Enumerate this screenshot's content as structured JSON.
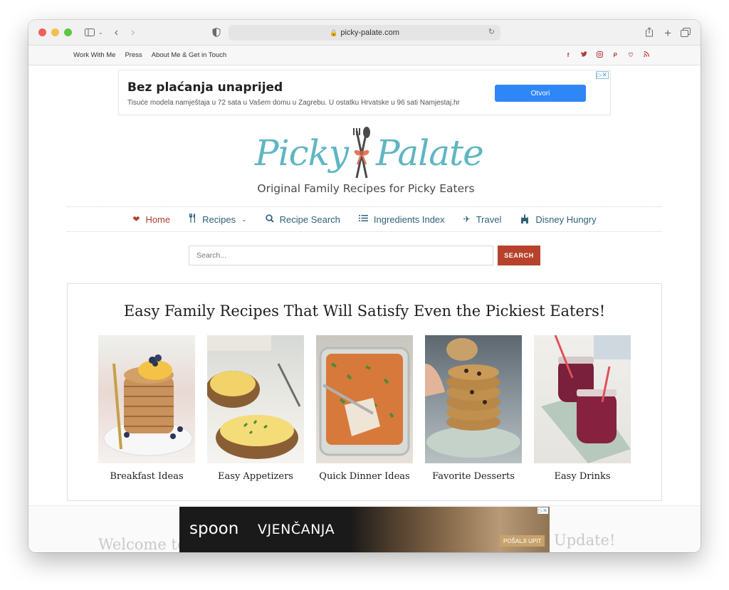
{
  "browser": {
    "url": "picky-palate.com",
    "traffic_lights": [
      "#ee5f57",
      "#f4bd4f",
      "#5ec545"
    ]
  },
  "bookmarks": [
    "Work With Me",
    "Press",
    "About Me & Get in Touch"
  ],
  "social_icons": [
    "facebook-icon",
    "twitter-icon",
    "instagram-icon",
    "pinterest-icon",
    "heart-icon",
    "rss-icon"
  ],
  "ad_top": {
    "title": "Bez plaćanja unaprijed",
    "subtitle": "Tisuće modela namještaja u 72 sata u Vašem domu u Zagrebu. U ostatku Hrvatske u 96 sati Namjestaj.hr",
    "button": "Otvori"
  },
  "logo": {
    "word1": "Picky",
    "word2": "Palate",
    "tagline": "Original Family Recipes for Picky Eaters"
  },
  "nav": {
    "items": [
      {
        "label": "Home",
        "icon": "heart-icon"
      },
      {
        "label": "Recipes",
        "icon": "utensils-icon"
      },
      {
        "label": "Recipe Search",
        "icon": "search-icon"
      },
      {
        "label": "Ingredients Index",
        "icon": "list-icon"
      },
      {
        "label": "Travel",
        "icon": "plane-icon"
      },
      {
        "label": "Disney Hungry",
        "icon": "castle-icon"
      }
    ]
  },
  "search": {
    "placeholder": "Search...",
    "button": "SEARCH"
  },
  "featured": {
    "heading": "Easy Family Recipes That Will Satisfy Even the Pickiest Eaters!",
    "cards": [
      {
        "label": "Breakfast Ideas"
      },
      {
        "label": "Easy Appetizers"
      },
      {
        "label": "Quick Dinner Ideas"
      },
      {
        "label": "Favorite Desserts"
      },
      {
        "label": "Easy Drinks"
      }
    ]
  },
  "below": {
    "left": "Welcome to",
    "right": "Update!"
  },
  "ad_bottom": {
    "brand": "spoon",
    "brand2": "VJENČANJA",
    "cta": "POŠALJI UPIT"
  },
  "colors": {
    "accent": "#b7422c",
    "nav_text": "#2e6179",
    "logo": "#5fb6c2"
  }
}
